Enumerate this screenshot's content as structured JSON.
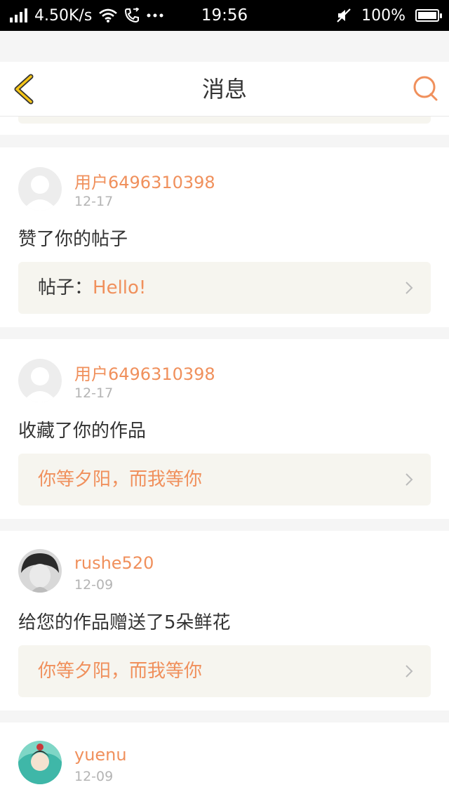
{
  "status_bar": {
    "speed": "4.50K/s",
    "icons_left": [
      "signal-icon",
      "wifi-icon",
      "call-icon",
      "more-dots-icon"
    ],
    "time": "19:56",
    "battery": "100%",
    "icons_right": [
      "mute-icon",
      "battery-icon"
    ]
  },
  "header": {
    "title": "消息",
    "back_icon": "chevron-left-icon",
    "search_icon": "search-icon",
    "accent_color": "#f0905c",
    "back_color": "#f5c518"
  },
  "messages": [
    {
      "user": "用户6496310398",
      "date": "12-17",
      "action": "赞了你的帖子",
      "ref_prefix": "帖子：",
      "ref_text": "Hello!"
    },
    {
      "user": "用户6496310398",
      "date": "12-17",
      "action": "收藏了你的作品",
      "ref_prefix": "",
      "ref_text": "你等夕阳，而我等你"
    },
    {
      "user": "rushe520",
      "date": "12-09",
      "action": "给您的作品赠送了5朵鲜花",
      "ref_prefix": "",
      "ref_text": "你等夕阳，而我等你"
    },
    {
      "user": "yuenu",
      "date": "12-09"
    }
  ]
}
